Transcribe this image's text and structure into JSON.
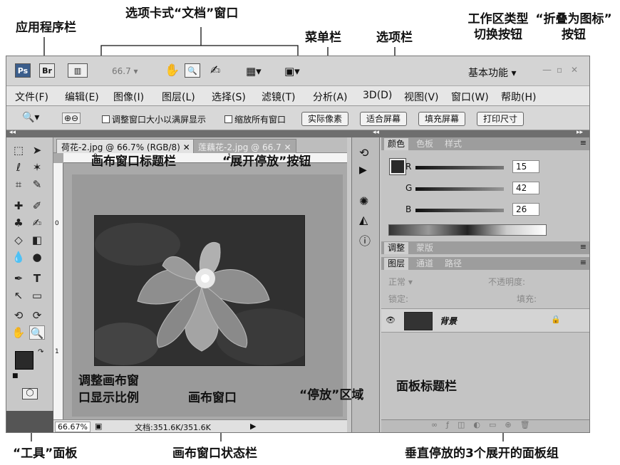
{
  "annotations": {
    "app_bar": "应用程序栏",
    "doc_window": "选项卡式“文档”窗口",
    "workspace_switch_1": "工作区类型",
    "workspace_switch_2": "切换按钮",
    "collapse_icons_1": "“折叠为图标”",
    "collapse_icons_2": "按钮",
    "menu_bar": "菜单栏",
    "options_bar": "选项栏",
    "canvas_title_bar": "画布窗口标题栏",
    "expand_dock": "“展开停放”按钮",
    "panel_title_bar": "面板标题栏",
    "zoom_1": "调整画布窗",
    "zoom_2": "口显示比例",
    "canvas_window": "画布窗口",
    "dock_area": "“停放”区域",
    "tools_panel": "“工具”面板",
    "canvas_status_bar": "画布窗口状态栏",
    "panel_groups": "垂直停放的3个展开的面板组"
  },
  "app_bar": {
    "ps_label": "Ps",
    "br_label": "Br",
    "zoom_value": "66.7",
    "workspace": "基本功能"
  },
  "menu": [
    "文件(F)",
    "编辑(E)",
    "图像(I)",
    "图层(L)",
    "选择(S)",
    "滤镜(T)",
    "分析(A)",
    "3D(D)",
    "视图(V)",
    "窗口(W)",
    "帮助(H)"
  ],
  "options": {
    "check_resize": "调整窗口大小以满屏显示",
    "check_all": "缩放所有窗口",
    "btn_actual": "实际像素",
    "btn_fit": "适合屏幕",
    "btn_fill": "填充屏幕",
    "btn_print": "打印尺寸"
  },
  "tabs": {
    "tab1": "荷花-2.jpg @ 66.7% (RGB/8)",
    "tab2": "莲藕花-2.jpg @ 66.7"
  },
  "ruler": {
    "zero": "0",
    "one": "1"
  },
  "status": {
    "zoom": "66.67%",
    "doc": "文档:351.6K/351.6K"
  },
  "color_panel": {
    "tabs": [
      "颜色",
      "色板",
      "样式"
    ],
    "r_label": "R",
    "r_value": "15",
    "g_label": "G",
    "g_value": "42",
    "b_label": "B",
    "b_value": "26"
  },
  "adjust_panel": {
    "tabs": [
      "调整",
      "蒙版"
    ]
  },
  "layers_panel": {
    "tabs": [
      "图层",
      "通道",
      "路径"
    ],
    "blend": "正常",
    "opacity": "不透明度:",
    "lock": "锁定:",
    "fill": "填充:",
    "layer_name": "背景"
  },
  "colors": {
    "accent": "#2a2a2a"
  }
}
